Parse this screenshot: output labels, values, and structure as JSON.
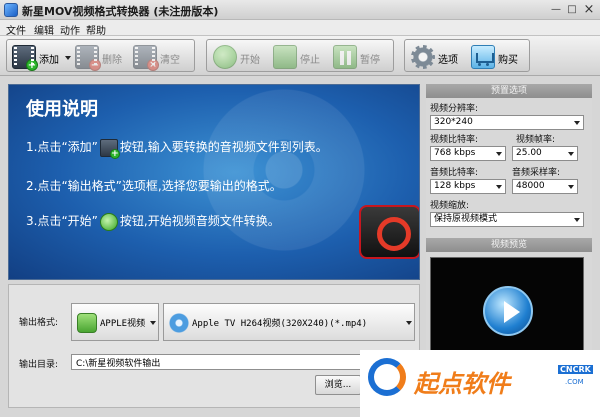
{
  "window": {
    "title": "新星MOV视频格式转换器 (未注册版本)"
  },
  "menu": [
    "文件",
    "编辑",
    "动作",
    "帮助"
  ],
  "toolbar": {
    "add": "添加",
    "delete": "删除",
    "clear": "清空",
    "start": "开始",
    "stop": "停止",
    "pause": "暂停",
    "options": "选项",
    "buy": "购买"
  },
  "banner": {
    "title": "使用说明",
    "step1_a": "1.点击“添加”",
    "step1_b": "按钮,输入要转换的音视频文件到列表。",
    "step2": "2.点击“输出格式”选项框,选择您要输出的格式。",
    "step3_a": "3.点击“开始”",
    "step3_b": "按钮,开始视频音频文件转换。"
  },
  "output": {
    "format_label": "输出格式:",
    "device_value": "APPLE视频",
    "format_value": "Apple TV H264视频(320X240)(*.mp4)",
    "dir_label": "输出目录:",
    "dir_value": "C:\\新星视频软件输出",
    "browse": "浏览..."
  },
  "settings": {
    "header": "预置选项",
    "resolution_label": "视频分辨率:",
    "resolution_value": "320*240",
    "video_bitrate_label": "视频比特率:",
    "video_bitrate_value": "768 kbps",
    "framerate_label": "视频帧率:",
    "framerate_value": "25.00",
    "audio_bitrate_label": "音频比特率:",
    "audio_bitrate_value": "128 kbps",
    "samplerate_label": "音频采样率:",
    "samplerate_value": "48000",
    "scale_label": "视频缩放:",
    "scale_value": "保持原视频模式"
  },
  "preview": {
    "header": "视频预览"
  },
  "watermark": {
    "text": "起点软件",
    "sub": "CNCRK",
    "com": ".COM"
  },
  "colors": {
    "banner": "#1d5fae",
    "accent_green": "#37a622",
    "watermark_orange": "#f07d1a",
    "watermark_blue": "#1b6fd3"
  }
}
